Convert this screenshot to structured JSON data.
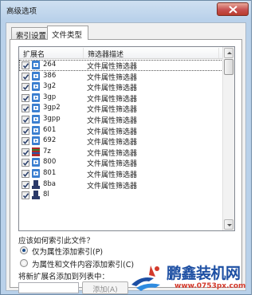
{
  "window": {
    "title": "高级选项"
  },
  "tabs": [
    {
      "label": "索引设置",
      "active": false
    },
    {
      "label": "文件类型",
      "active": true
    }
  ],
  "list": {
    "headers": {
      "extension": "扩展名",
      "description": "筛选器描述"
    },
    "rows": [
      {
        "checked": true,
        "icon": "media-file-icon",
        "ext": "264",
        "desc": "文件属性筛选器",
        "selected": true
      },
      {
        "checked": true,
        "icon": "video-file-icon",
        "ext": "386",
        "desc": "文件属性筛选器"
      },
      {
        "checked": true,
        "icon": "media-file-icon",
        "ext": "3g2",
        "desc": "文件属性筛选器"
      },
      {
        "checked": true,
        "icon": "media-file-icon",
        "ext": "3gp",
        "desc": "文件属性筛选器"
      },
      {
        "checked": true,
        "icon": "media-file-icon",
        "ext": "3gp2",
        "desc": "文件属性筛选器"
      },
      {
        "checked": true,
        "icon": "media-file-icon",
        "ext": "3gpp",
        "desc": "文件属性筛选器"
      },
      {
        "checked": true,
        "icon": "media-file-icon",
        "ext": "601",
        "desc": "文件属性筛选器"
      },
      {
        "checked": true,
        "icon": "media-file-icon",
        "ext": "692",
        "desc": "文件属性筛选器"
      },
      {
        "checked": true,
        "icon": "archive-file-icon",
        "ext": "7z",
        "desc": "文件属性筛选器"
      },
      {
        "checked": true,
        "icon": "media-file-icon",
        "ext": "800",
        "desc": "文件属性筛选器"
      },
      {
        "checked": true,
        "icon": "media-file-icon",
        "ext": "801",
        "desc": "文件属性筛选器"
      },
      {
        "checked": true,
        "icon": "generic-file-icon",
        "ext": "8ba",
        "desc": "文件属性筛选器"
      },
      {
        "checked": true,
        "icon": "generic-file-icon",
        "ext": "8l",
        "desc": ""
      }
    ]
  },
  "index_options": {
    "question": "应该如何索引此文件？",
    "options": [
      {
        "label": "仅为属性添加索引(P)",
        "selected": true
      },
      {
        "label": "为属性和文件内容添加索引(C)",
        "selected": false
      }
    ]
  },
  "add_extension": {
    "label": "将新扩展名添加到列表中：",
    "input_value": "",
    "button_label": "添加(A)"
  },
  "watermark": {
    "brand": "鹏鑫装机网",
    "url": "www.0753px.com"
  },
  "colors": {
    "media_icon": "#3b7fd0",
    "archive_icon": "#b0282a",
    "generic_icon": "#2b3a6a",
    "brand_blue": "#1d4fa3",
    "brand_red": "#d33a2c"
  }
}
